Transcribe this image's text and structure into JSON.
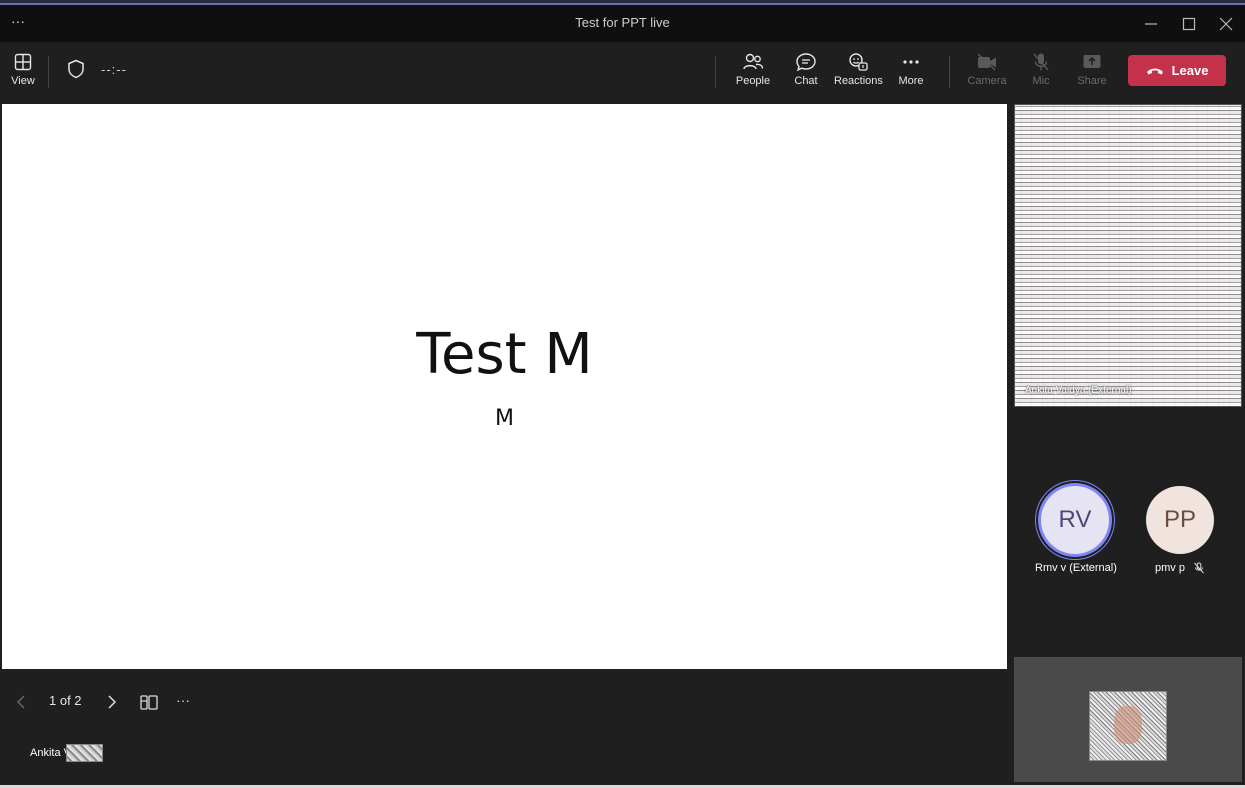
{
  "window": {
    "title": "Test for PPT live",
    "more_glyph": "···"
  },
  "toolbar": {
    "view_label": "View",
    "timer": "--:--",
    "people_label": "People",
    "chat_label": "Chat",
    "reactions_label": "Reactions",
    "more_label": "More",
    "camera_label": "Camera",
    "mic_label": "Mic",
    "share_label": "Share",
    "leave_label": "Leave",
    "leave_color": "#c4314b"
  },
  "slide": {
    "title": "Test M",
    "subtitle": "M"
  },
  "slide_controls": {
    "page_indicator": "1 of 2",
    "more_glyph": "···"
  },
  "presenter": {
    "name": "Ankita V"
  },
  "participants": {
    "video_tile_name": "Ankita Vaidya (External)",
    "rv": {
      "initials": "RV",
      "name": "Rmv v (External)"
    },
    "pp": {
      "initials": "PP",
      "name": "pmv p"
    }
  }
}
